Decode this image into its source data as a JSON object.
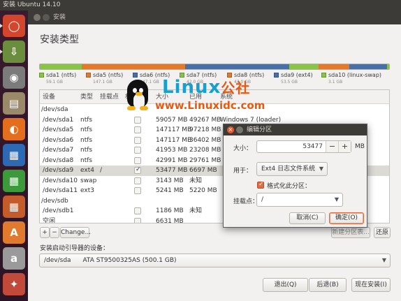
{
  "top_panel": {
    "title": "安装 Ubuntu 14.10"
  },
  "launcher": {
    "items": [
      {
        "name": "ubuntu",
        "glyph": "◯",
        "color": "#d2462d"
      },
      {
        "name": "installer",
        "glyph": "⇩",
        "color": "#6b8e3e"
      },
      {
        "name": "camera",
        "glyph": "◉",
        "color": "#7b7b7b"
      },
      {
        "name": "files",
        "glyph": "▤",
        "color": "#9a8a6a"
      },
      {
        "name": "firefox",
        "glyph": "◐",
        "color": "#e36f1e"
      },
      {
        "name": "writer",
        "glyph": "▦",
        "color": "#2e6ab3"
      },
      {
        "name": "calc",
        "glyph": "▦",
        "color": "#3c9a3c"
      },
      {
        "name": "impress",
        "glyph": "▦",
        "color": "#c35b2a"
      },
      {
        "name": "software-center",
        "glyph": "A",
        "color": "#e07a2e"
      },
      {
        "name": "amazon",
        "glyph": "a",
        "color": "#9a9a9a"
      },
      {
        "name": "settings",
        "glyph": "✦",
        "color": "#c24a3a"
      }
    ]
  },
  "window": {
    "title": "安装"
  },
  "page": {
    "title": "安装类型"
  },
  "partition_bar": {
    "segments": [
      {
        "name": "sda1 (ntfs)",
        "size": "59.1 GB",
        "color": "#8bc34a",
        "share": 59.1
      },
      {
        "name": "sda5 (ntfs)",
        "size": "147.1 GB",
        "color": "#e07a2e",
        "share": 147.1
      },
      {
        "name": "sda6 (ntfs)",
        "size": "147.1 GB",
        "color": "#4a6fa5",
        "share": 147.1
      },
      {
        "name": "sda7 (ntfs)",
        "size": "42.0 GB",
        "color": "#8bc34a",
        "share": 42.0
      },
      {
        "name": "sda8 (ntfs)",
        "size": "43.0 GB",
        "color": "#e07a2e",
        "share": 43.0
      },
      {
        "name": "sda9 (ext4)",
        "size": "53.5 GB",
        "color": "#4a6fa5",
        "share": 53.5
      },
      {
        "name": "sda10 (linux-swap)",
        "size": "3.1 GB",
        "color": "#8bc34a",
        "share": 3.1
      }
    ]
  },
  "table": {
    "headers": [
      "设备",
      "类型",
      "挂载点",
      "格",
      "大小",
      "已用",
      "系统"
    ],
    "rows": [
      {
        "device": "/dev/sda",
        "type": "",
        "mount": "",
        "format": null,
        "size": "",
        "used": "",
        "system": ""
      },
      {
        "device": "/dev/sda1",
        "type": "ntfs",
        "mount": "",
        "format": false,
        "size": "59057 MB",
        "used": "49267 MB",
        "system": "Windows 7 (loader)"
      },
      {
        "device": "/dev/sda5",
        "type": "ntfs",
        "mount": "",
        "format": false,
        "size": "147117 MB",
        "used": "97218 MB",
        "system": ""
      },
      {
        "device": "/dev/sda6",
        "type": "ntfs",
        "mount": "",
        "format": false,
        "size": "147117 MB",
        "used": "36402 MB",
        "system": ""
      },
      {
        "device": "/dev/sda7",
        "type": "ntfs",
        "mount": "",
        "format": false,
        "size": "41953 MB",
        "used": "23208 MB",
        "system": ""
      },
      {
        "device": "/dev/sda8",
        "type": "ntfs",
        "mount": "",
        "format": false,
        "size": "42991 MB",
        "used": "29761 MB",
        "system": ""
      },
      {
        "device": "/dev/sda9",
        "type": "ext4",
        "mount": "/",
        "format": true,
        "size": "53477 MB",
        "used": "6697 MB",
        "system": ""
      },
      {
        "device": "/dev/sda10",
        "type": "swap",
        "mount": "",
        "format": false,
        "size": "3143 MB",
        "used": "未知",
        "system": ""
      },
      {
        "device": "/dev/sda11",
        "type": "ext3",
        "mount": "",
        "format": false,
        "size": "5241 MB",
        "used": "5220 MB",
        "system": ""
      },
      {
        "device": "/dev/sdb",
        "type": "",
        "mount": "",
        "format": null,
        "size": "",
        "used": "",
        "system": ""
      },
      {
        "device": "/dev/sdb1",
        "type": "",
        "mount": "",
        "format": false,
        "size": "1186 MB",
        "used": "未知",
        "system": ""
      },
      {
        "device": "空闲",
        "type": "",
        "mount": "",
        "format": false,
        "size": "6631 MB",
        "used": "",
        "system": ""
      }
    ],
    "selected_index": 6
  },
  "watermark": {
    "brand": "Linux",
    "brand_cn": "公社",
    "url": "www.Linuxidc.com"
  },
  "table_controls": {
    "add": "+",
    "remove": "−",
    "change": "Change...",
    "new_partition_table": "新建分区表...",
    "revert": "还原"
  },
  "bootloader": {
    "label": "安装启动引导器的设备：",
    "device": "/dev/sda",
    "description": "ATA ST9500325AS (500.1 GB)"
  },
  "buttons": {
    "quit": "退出(Q)",
    "back": "后退(B)",
    "install_now": "现在安装(I)"
  },
  "dialog": {
    "title": "编辑分区",
    "size_label": "大小：",
    "size_value": "53477",
    "size_unit": "MB",
    "minus": "−",
    "plus": "+",
    "use_label": "用于：",
    "use_value": "Ext4 日志文件系统",
    "format_label": "格式化此分区：",
    "format_checked": true,
    "mount_label": "挂载点：",
    "mount_value": "/",
    "cancel": "取消(C)",
    "ok": "确定(O)"
  }
}
